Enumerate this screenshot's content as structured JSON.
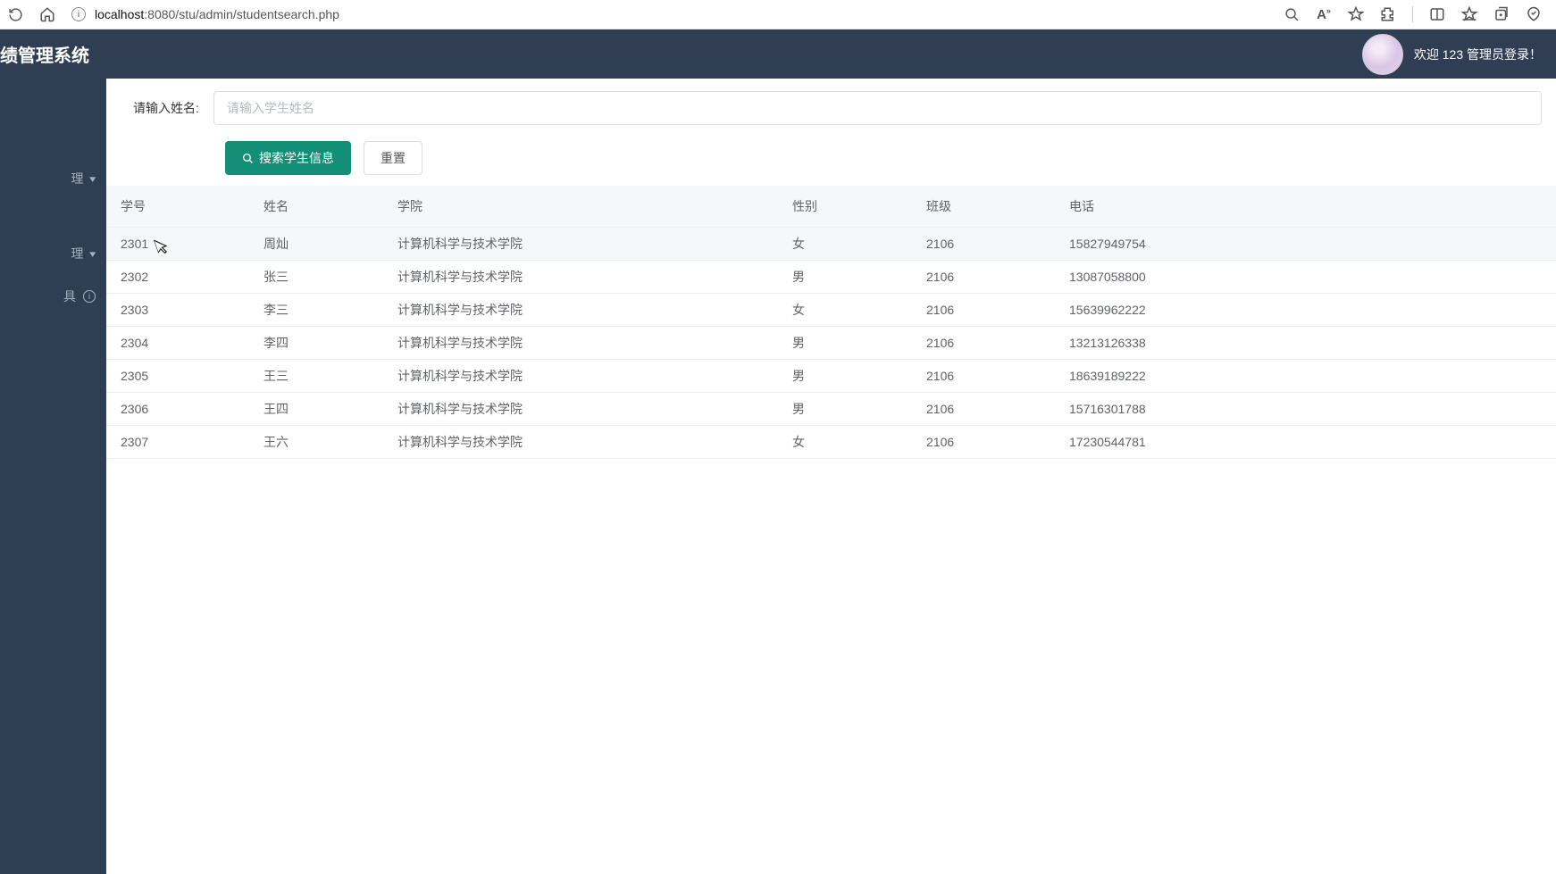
{
  "browser": {
    "url_host": "localhost",
    "url_rest": ":8080/stu/admin/studentsearch.php"
  },
  "header": {
    "app_title": "绩管理系统",
    "welcome_text": "欢迎 123 管理员登录！"
  },
  "sidebar": {
    "items": [
      {
        "label": "理",
        "has_chevron": true
      },
      {
        "label": "理",
        "has_chevron": true
      },
      {
        "label": "具",
        "has_info": true
      }
    ]
  },
  "search": {
    "label": "请输入姓名:",
    "placeholder": "请输入学生姓名",
    "search_btn": "搜索学生信息",
    "reset_btn": "重置"
  },
  "table": {
    "headers": {
      "id": "学号",
      "name": "姓名",
      "college": "学院",
      "gender": "性别",
      "class": "班级",
      "phone": "电话"
    },
    "rows": [
      {
        "id": "2301",
        "name": "周灿",
        "college": "计算机科学与技术学院",
        "gender": "女",
        "class": "2106",
        "phone": "15827949754"
      },
      {
        "id": "2302",
        "name": "张三",
        "college": "计算机科学与技术学院",
        "gender": "男",
        "class": "2106",
        "phone": "13087058800"
      },
      {
        "id": "2303",
        "name": "李三",
        "college": "计算机科学与技术学院",
        "gender": "女",
        "class": "2106",
        "phone": "15639962222"
      },
      {
        "id": "2304",
        "name": "李四",
        "college": "计算机科学与技术学院",
        "gender": "男",
        "class": "2106",
        "phone": "13213126338"
      },
      {
        "id": "2305",
        "name": "王三",
        "college": "计算机科学与技术学院",
        "gender": "男",
        "class": "2106",
        "phone": "18639189222"
      },
      {
        "id": "2306",
        "name": "王四",
        "college": "计算机科学与技术学院",
        "gender": "男",
        "class": "2106",
        "phone": "15716301788"
      },
      {
        "id": "2307",
        "name": "王六",
        "college": "计算机科学与技术学院",
        "gender": "女",
        "class": "2106",
        "phone": "17230544781"
      }
    ]
  }
}
